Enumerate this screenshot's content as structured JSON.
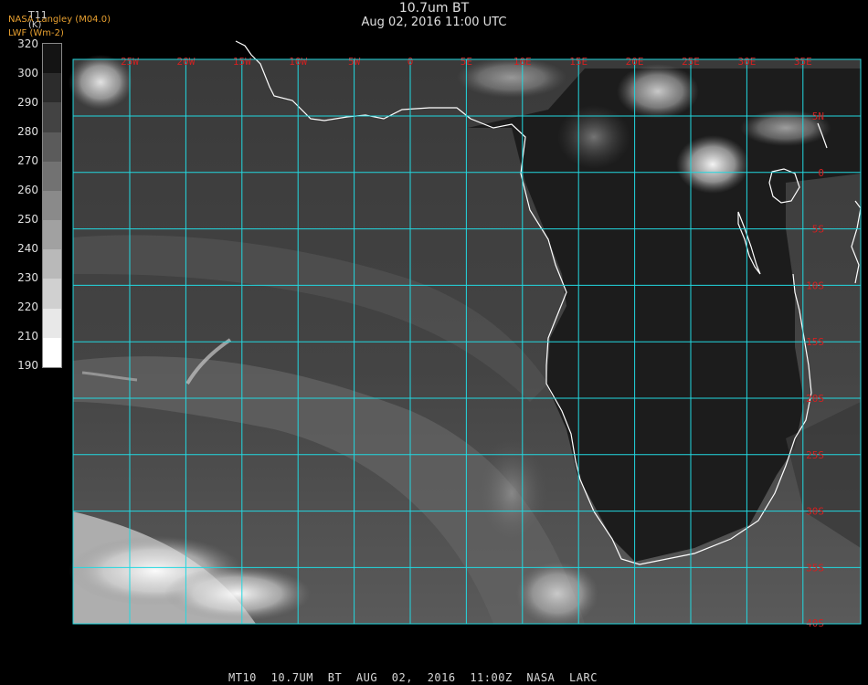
{
  "header": {
    "title": "10.7um BT",
    "date": "Aug 02, 2016 11:00 UTC",
    "credit_line1": "NASA Langley (M04.0)",
    "credit_line2": "LWF (Wm-2)"
  },
  "colorbar": {
    "label": "T11",
    "unit": "(K)",
    "ticks": [
      "320",
      "300",
      "290",
      "280",
      "270",
      "260",
      "250",
      "240",
      "230",
      "220",
      "210",
      "190"
    ]
  },
  "map": {
    "lon_labels": [
      "25W",
      "20W",
      "15W",
      "10W",
      "5W",
      "0",
      "5E",
      "10E",
      "15E",
      "20E",
      "25E",
      "30E",
      "35E"
    ],
    "lat_labels": [
      "5N",
      "0",
      "5S",
      "10S",
      "15S",
      "20S",
      "25S",
      "30S",
      "35S",
      "40S"
    ],
    "grid_color": "#22d8e0",
    "label_color": "#d42020",
    "coast_color": "#ffffff"
  },
  "footer": {
    "satellite": "MT10",
    "channel": "10.7UM BT",
    "date": "AUG 02, 2016 11:00Z",
    "source": "NASA LARC"
  }
}
